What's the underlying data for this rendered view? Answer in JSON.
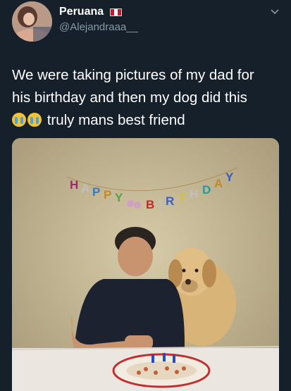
{
  "author": {
    "display_name": "Peruana",
    "handle": "@Alejandraaa__",
    "flag_icon": "peru-flag-icon",
    "avatar_icon": "profile-avatar"
  },
  "tweet": {
    "line1": "We were taking pictures of my dad for",
    "line2": "his birthday and then my dog did this",
    "line3_emoji": "loudly-crying-face-emoji",
    "line3_text": "truly mans best friend"
  },
  "photo": {
    "banner_text": "HAPPY BIRTHDAY"
  },
  "colors": {
    "background": "#15202b",
    "text": "#ffffff",
    "secondary_text": "#8899a6",
    "peru_red": "#d91023"
  },
  "icons": {
    "more": "chevron-down-icon"
  }
}
